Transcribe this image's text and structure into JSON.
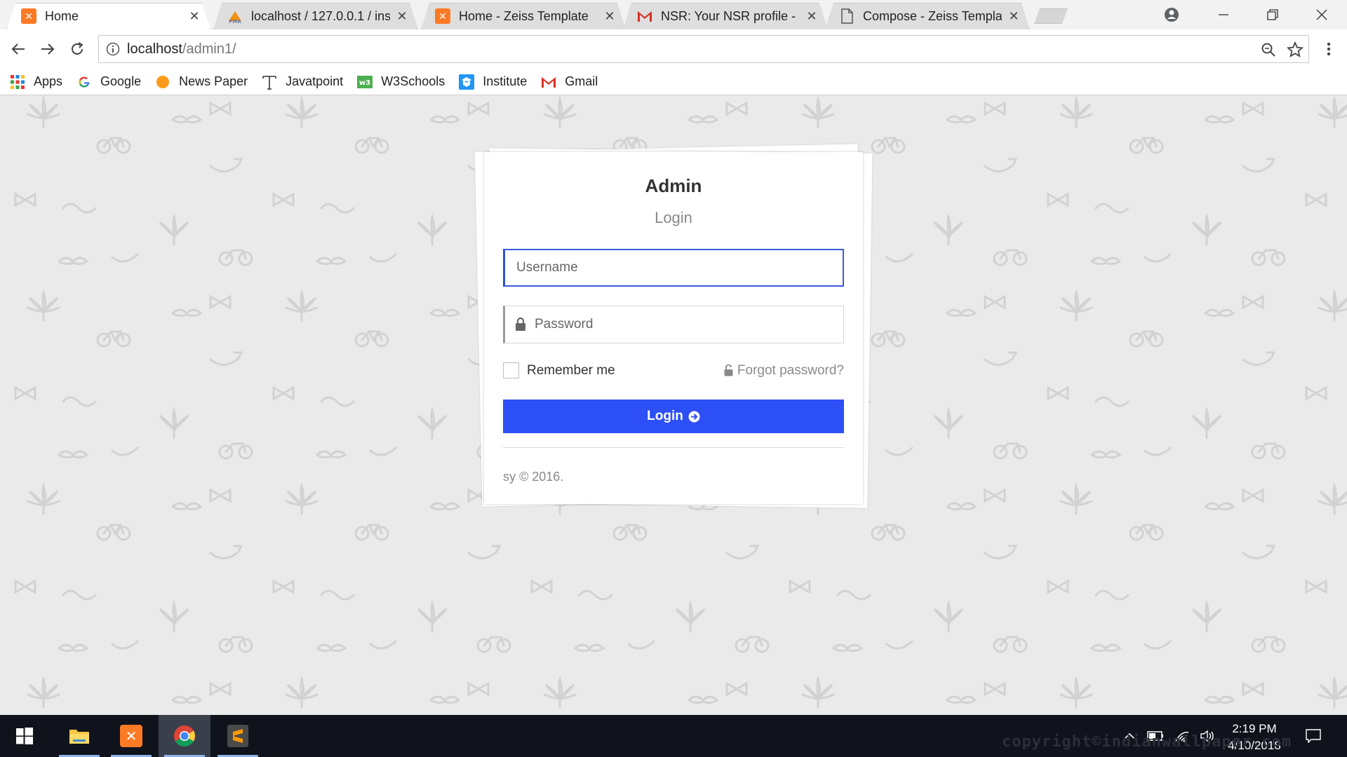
{
  "browser": {
    "tabs": [
      {
        "title": "Home",
        "favicon": "xampp-icon",
        "active": true
      },
      {
        "title": "localhost / 127.0.0.1 / ins",
        "favicon": "phpmyadmin-icon",
        "active": false
      },
      {
        "title": "Home - Zeiss Template",
        "favicon": "xampp-icon",
        "active": false
      },
      {
        "title": "NSR: Your NSR profile - s",
        "favicon": "gmail-icon",
        "active": false
      },
      {
        "title": "Compose - Zeiss Templa",
        "favicon": "document-icon",
        "active": false
      }
    ],
    "url_host": "localhost",
    "url_path": "/admin1/",
    "bookmarks": [
      {
        "label": "Apps",
        "icon": "apps-grid-icon"
      },
      {
        "label": "Google",
        "icon": "google-icon"
      },
      {
        "label": "News Paper",
        "icon": "orange-dot-icon"
      },
      {
        "label": "Javatpoint",
        "icon": "javatpoint-icon"
      },
      {
        "label": "W3Schools",
        "icon": "w3schools-icon"
      },
      {
        "label": "Institute",
        "icon": "institute-icon"
      },
      {
        "label": "Gmail",
        "icon": "gmail-icon"
      }
    ]
  },
  "login": {
    "title": "Admin",
    "subtitle": "Login",
    "username_placeholder": "Username",
    "password_placeholder": "Password",
    "remember_label": "Remember me",
    "forgot_label": "Forgot password?",
    "button_label": "Login",
    "footer": "sy © 2016."
  },
  "taskbar": {
    "time": "2:19 PM",
    "date": "4/10/2018",
    "watermark": "copyright©indianwallpaper.com"
  },
  "colors": {
    "accent": "#2d4ff6",
    "input_focus": "#3a5bdb",
    "page_bg": "#eaeaea",
    "taskbar_bg": "#10131c"
  }
}
